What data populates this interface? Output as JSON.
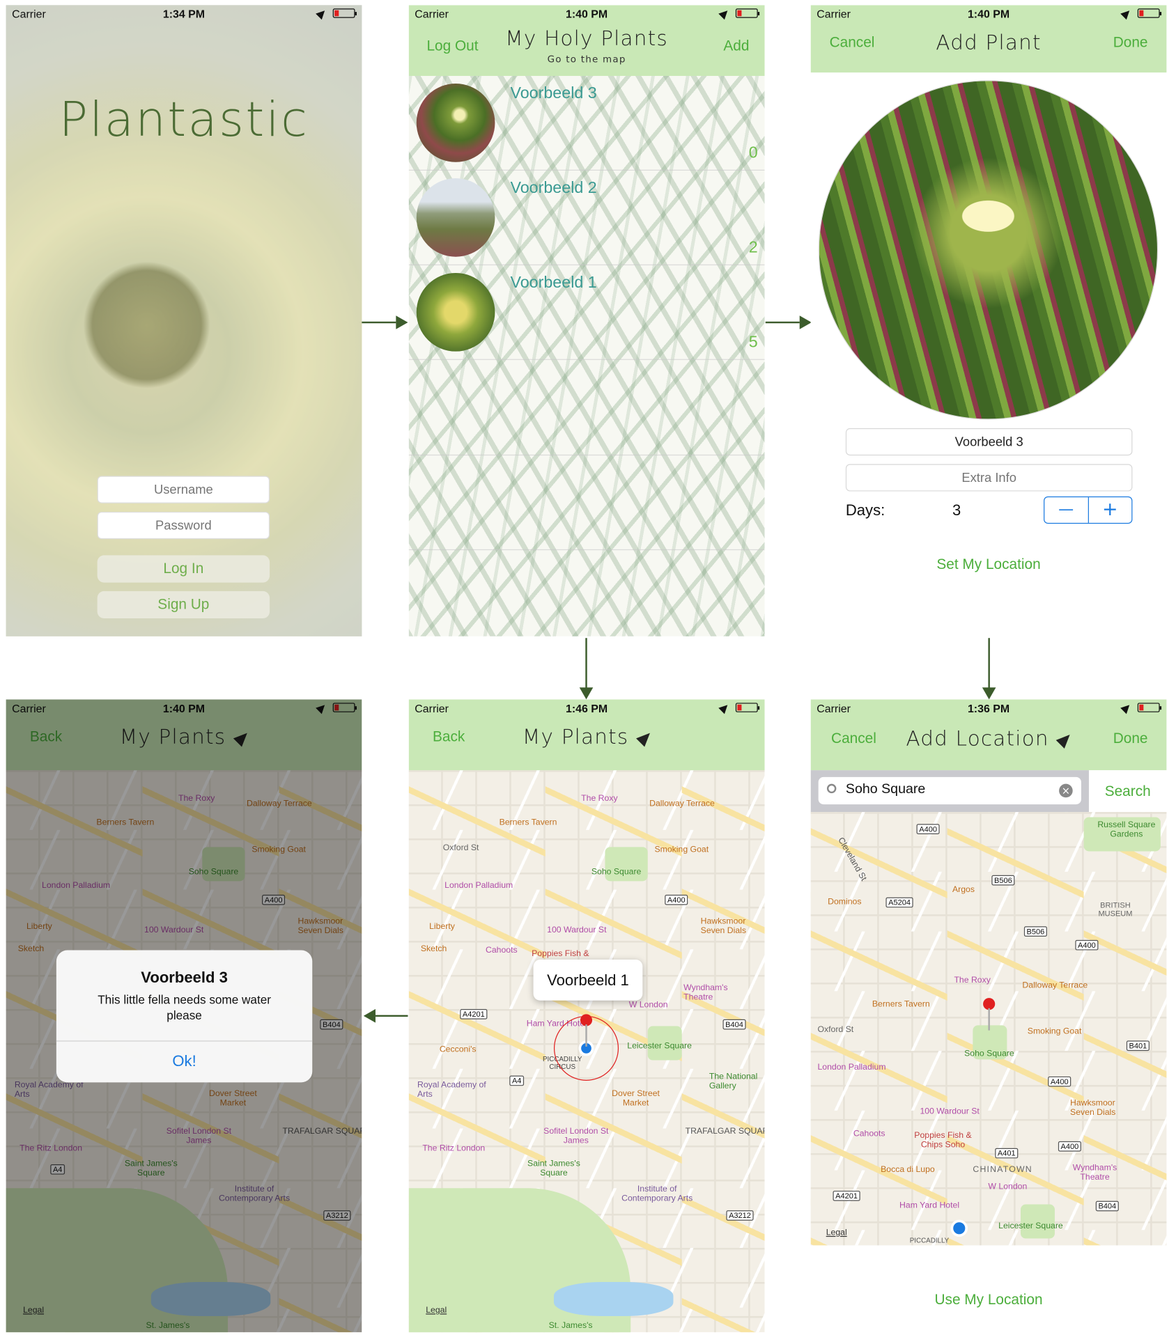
{
  "status_bars": {
    "carrier": "Carrier",
    "login_time": "1:34 PM",
    "list_time": "1:40 PM",
    "addplant_time": "1:40 PM",
    "alert_time": "1:40 PM",
    "map_time": "1:46 PM",
    "addloc_time": "1:36 PM"
  },
  "login": {
    "app_title": "Plantastic",
    "username_placeholder": "Username",
    "password_placeholder": "Password",
    "login_label": "Log In",
    "signup_label": "Sign Up"
  },
  "plant_list": {
    "logout_label": "Log Out",
    "title": "My Holy Plants",
    "subtitle": "Go to the map",
    "add_label": "Add",
    "rows": [
      {
        "name": "Voorbeeld 3",
        "days": "0"
      },
      {
        "name": "Voorbeeld 2",
        "days": "2"
      },
      {
        "name": "Voorbeeld 1",
        "days": "5"
      }
    ]
  },
  "add_plant": {
    "cancel_label": "Cancel",
    "title": "Add Plant",
    "done_label": "Done",
    "name_value": "Voorbeeld 3",
    "extra_placeholder": "Extra Info",
    "days_label": "Days:",
    "days_value": "3",
    "minus": "—",
    "plus": "+",
    "set_location_label": "Set My Location"
  },
  "map_screen": {
    "back_label": "Back",
    "title": "My Plants",
    "callout": "Voorbeeld 1",
    "legal": "Legal"
  },
  "alert": {
    "title": "Voorbeeld 3",
    "message": "This little fella needs some water please",
    "ok_label": "Ok!"
  },
  "add_location": {
    "cancel_label": "Cancel",
    "title": "Add Location",
    "done_label": "Done",
    "search_value": "Soho Square",
    "search_button": "Search",
    "use_location_label": "Use My Location",
    "legal": "Legal"
  },
  "map_labels": [
    "The Roxy",
    "Dalloway Terrace",
    "Berners Tavern",
    "Oxford St",
    "Smoking Goat",
    "Soho Square",
    "London Palladium",
    "A400",
    "Liberty",
    "100 Wardour St",
    "Hawksmoor Seven Dials",
    "Sketch",
    "Cahoots",
    "Poppies Fish &",
    "A4201",
    "Ham Yard Hotel",
    "Leicester Square",
    "Cecconi's",
    "PICCADILLY CIRCUS",
    "Royal Academy of Arts",
    "Dover Street Market",
    "The National Gallery",
    "Sofitel London St James",
    "TRAFALGAR SQUARE",
    "The Ritz London",
    "Saint James's Square",
    "Institute of Contemporary Arts",
    "A3212",
    "St. James's",
    "B404",
    "A4",
    "W London",
    "Wyndham's Theatre"
  ],
  "addloc_map_labels": [
    "A400",
    "Russell Square Gardens",
    "Cleveland St",
    "Argos",
    "B506",
    "Dominos",
    "A5204",
    "BRITISH MUSEUM",
    "B506",
    "A400",
    "The Roxy",
    "Dalloway Terrace",
    "Berners Tavern",
    "Oxford St",
    "Smoking Goat",
    "Soho Square",
    "B401",
    "London Palladium",
    "A400",
    "Hawksmoor Seven Dials",
    "100 Wardour St",
    "Cahoots",
    "Poppies Fish & Chips Soho",
    "A401",
    "A400",
    "Bocca di Lupo",
    "CHINATOWN",
    "Wyndham's Theatre",
    "A4201",
    "W London",
    "Ham Yard Hotel",
    "B404",
    "Leicester Square",
    "PICCADILLY"
  ]
}
